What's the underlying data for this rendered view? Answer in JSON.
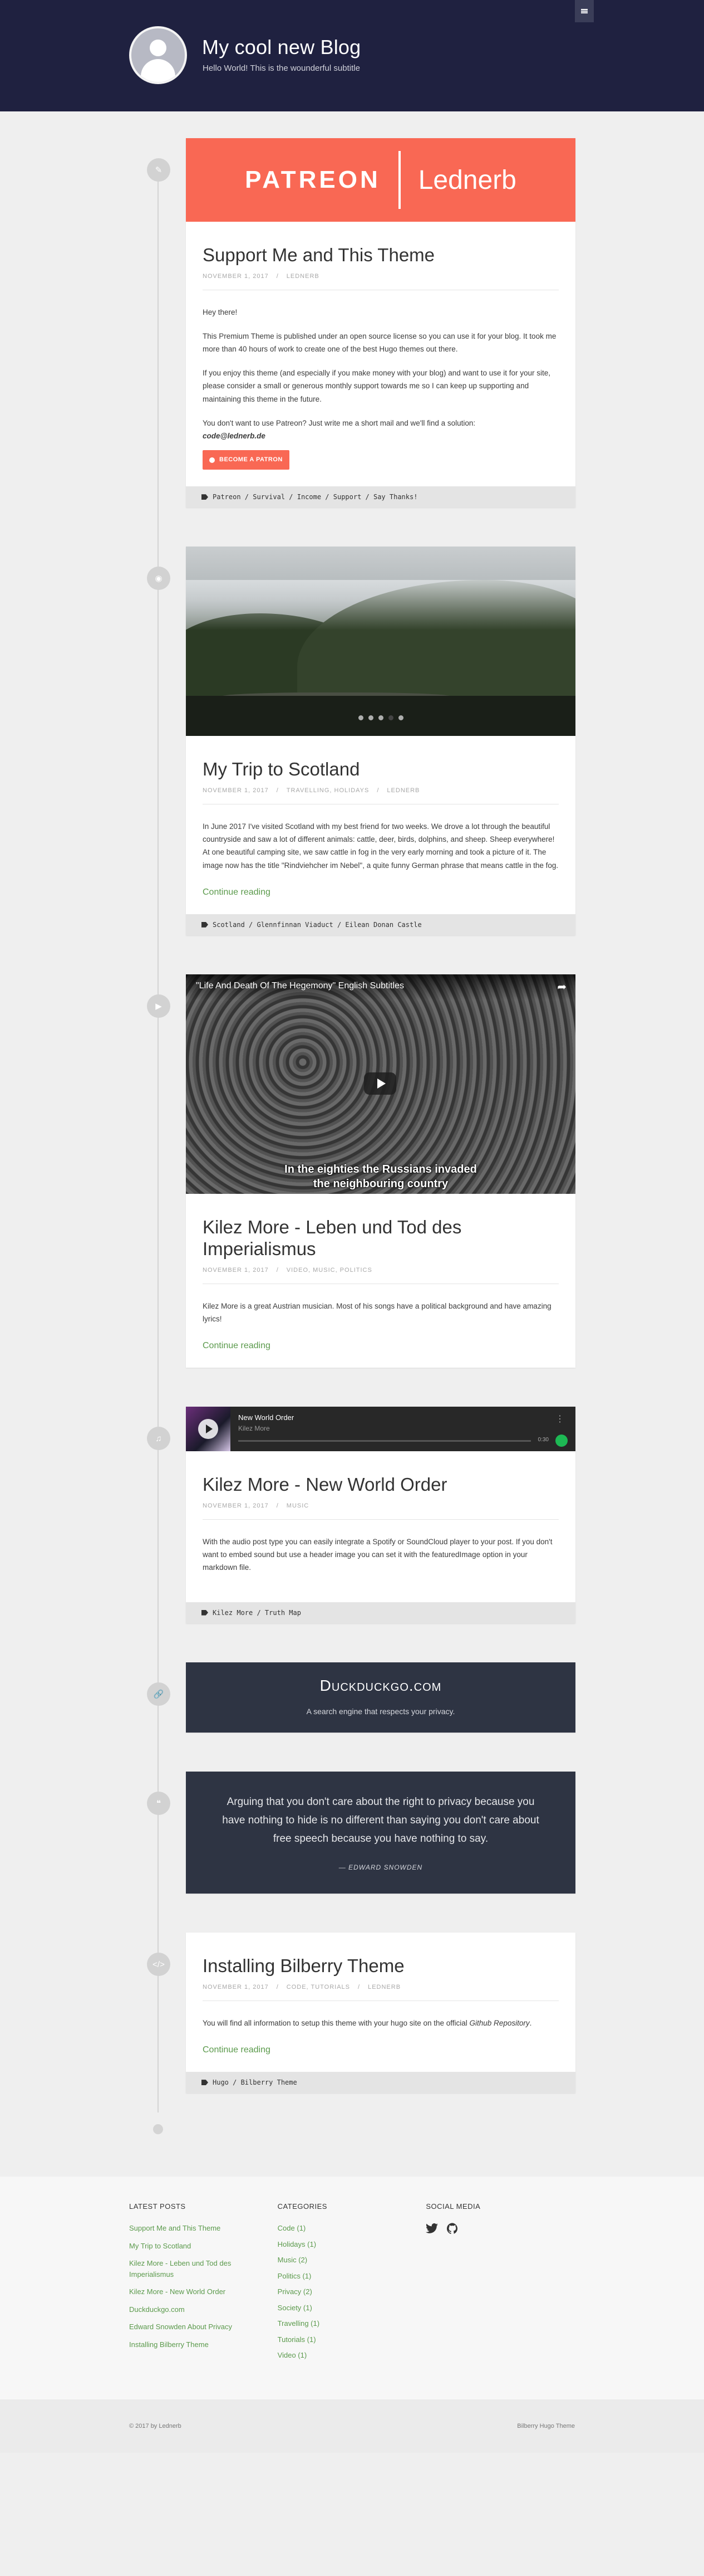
{
  "header": {
    "title": "My cool new Blog",
    "subtitle": "Hello World! This is the wounderful subtitle"
  },
  "posts": {
    "patreon": {
      "banner_brand": "PATREON",
      "banner_user": "Lednerb",
      "title": "Support Me and This Theme",
      "date": "NOVEMBER 1, 2017",
      "author": "LEDNERB",
      "p1": "Hey there!",
      "p2": "This Premium Theme is published under an open source license so you can use it for your blog. It took me more than 40 hours of work to create one of the best Hugo themes out there.",
      "p3": "If you enjoy this theme (and especially if you make money with your blog) and want to use it for your site, please consider a small or generous monthly support towards me so I can keep up supporting and maintaining this theme in the future.",
      "p4": "You don't want to use Patreon? Just write me a short mail and we'll find a solution:",
      "email": "code@lednerb.de",
      "button": "BECOME A PATRON",
      "tags": "Patreon / Survival / Income / Support / Say Thanks!"
    },
    "scotland": {
      "title": "My Trip to Scotland",
      "date": "NOVEMBER 1, 2017",
      "categories": "TRAVELLING, HOLIDAYS",
      "author": "LEDNERB",
      "text": "In June 2017 I've visited Scotland with my best friend for two weeks. We drove a lot through the beautiful countryside and saw a lot of different animals: cattle, deer, birds, dolphins, and sheep. Sheep everywhere! At one beautiful camping site, we saw cattle in fog in the very early morning and took a picture of it. The image now has the title \"Rindviehcher im Nebel\", a quite funny German phrase that means cattle in the fog.",
      "continue": "Continue reading",
      "tags": "Scotland / Glennfinnan Viaduct / Eilean Donan Castle"
    },
    "video": {
      "video_title": "\"Life And Death Of The Hegemony\" English Subtitles",
      "sub_line1": "In the eighties the Russians invaded",
      "sub_line2": "the neighbouring country",
      "title": "Kilez More - Leben und Tod des Imperialismus",
      "date": "NOVEMBER 1, 2017",
      "categories": "VIDEO, MUSIC, POLITICS",
      "text": "Kilez More is a great Austrian musician. Most of his songs have a political background and have amazing lyrics!",
      "continue": "Continue reading"
    },
    "audio": {
      "track": "New World Order",
      "artist": "Kilez More",
      "time": "0:30",
      "title": "Kilez More - New World Order",
      "date": "NOVEMBER 1, 2017",
      "categories": "MUSIC",
      "text": "With the audio post type you can easily integrate a Spotify or SoundCloud player to your post. If you don't want to embed sound but use a header image you can set it with the featuredImage option in your markdown file.",
      "tags": "Kilez More / Truth Map"
    },
    "link": {
      "title": "Duckduckgo.com",
      "desc": "A search engine that respects your privacy."
    },
    "quote": {
      "text": "Arguing that you don't care about the right to privacy because you have nothing to hide is no different than saying you don't care about free speech because you have nothing to say.",
      "author": "— EDWARD SNOWDEN"
    },
    "bilberry": {
      "title": "Installing Bilberry Theme",
      "date": "NOVEMBER 1, 2017",
      "categories": "CODE, TUTORIALS",
      "author": "LEDNERB",
      "text_a": "You will find all information to setup this theme with your hugo site on the official ",
      "text_link": "Github Repository",
      "text_b": ".",
      "continue": "Continue reading",
      "tags": "Hugo / Bilberry Theme"
    }
  },
  "footer": {
    "latest_heading": "LATEST POSTS",
    "latest": [
      "Support Me and This Theme",
      "My Trip to Scotland",
      "Kilez More - Leben und Tod des Imperialismus",
      "Kilez More - New World Order",
      "Duckduckgo.com",
      "Edward Snowden About Privacy",
      "Installing Bilberry Theme"
    ],
    "categories_heading": "CATEGORIES",
    "categories": [
      "Code (1)",
      "Holidays (1)",
      "Music (2)",
      "Politics (1)",
      "Privacy (2)",
      "Society (1)",
      "Travelling (1)",
      "Tutorials (1)",
      "Video (1)"
    ],
    "social_heading": "SOCIAL MEDIA",
    "copyright": "© 2017 by Lednerb",
    "theme": "Bilberry Hugo Theme"
  },
  "colors": {
    "header_bg": "#1f2140",
    "accent": "#5b9a4c",
    "patreon": "#f96854",
    "dark_card": "#2e3443"
  }
}
